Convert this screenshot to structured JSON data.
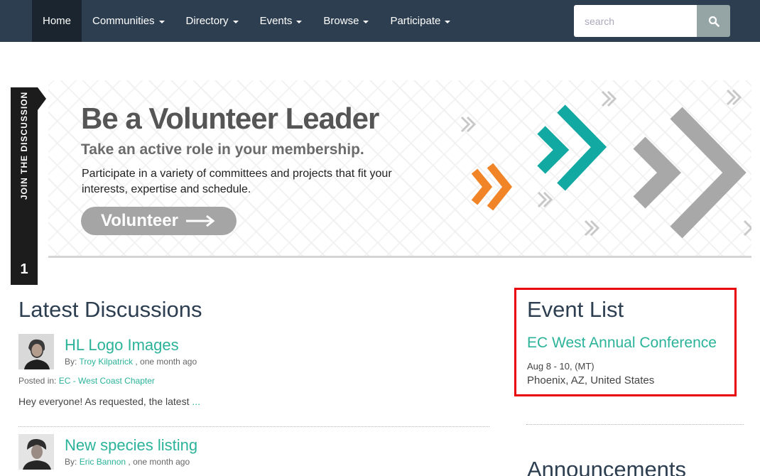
{
  "nav": {
    "items": [
      {
        "label": "Home",
        "dropdown": false
      },
      {
        "label": "Communities",
        "dropdown": true
      },
      {
        "label": "Directory",
        "dropdown": true
      },
      {
        "label": "Events",
        "dropdown": true
      },
      {
        "label": "Browse",
        "dropdown": true
      },
      {
        "label": "Participate",
        "dropdown": true
      }
    ],
    "search_placeholder": "search",
    "search_icon": "search-icon"
  },
  "banner": {
    "title": "Be a Volunteer Leader",
    "subtitle": "Take an active role in your membership.",
    "text": "Participate in a variety of committees and projects that fit your interests, expertise and schedule.",
    "button_label": "Volunteer",
    "colors": {
      "teal": "#13a9a3",
      "orange": "#f08427",
      "gray": "#a8a8a8"
    }
  },
  "side_tab": {
    "label": "JOIN THE DISCUSSION",
    "count": "1"
  },
  "discussions": {
    "title": "Latest Discussions",
    "items": [
      {
        "title": "HL Logo Images",
        "by_prefix": "By:",
        "author": "Troy Kilpatrick",
        "time": ", one month ago",
        "posted_prefix": "Posted in:",
        "community": "EC - West Coast Chapter",
        "excerpt": "Hey everyone! As requested, the latest",
        "more": "..."
      },
      {
        "title": "New species listing",
        "by_prefix": "By:",
        "author": "Eric Bannon",
        "time": ", one month ago"
      }
    ]
  },
  "events": {
    "title": "Event List",
    "event_title": "EC West Annual Conference",
    "date": "Aug 8 - 10, (MT)",
    "location": "Phoenix, AZ, United States"
  },
  "announcements": {
    "title": "Announcements"
  },
  "colors": {
    "navbar": "#2c3e50",
    "accent": "#2bb39a",
    "highlight_border": "#e8000b"
  }
}
